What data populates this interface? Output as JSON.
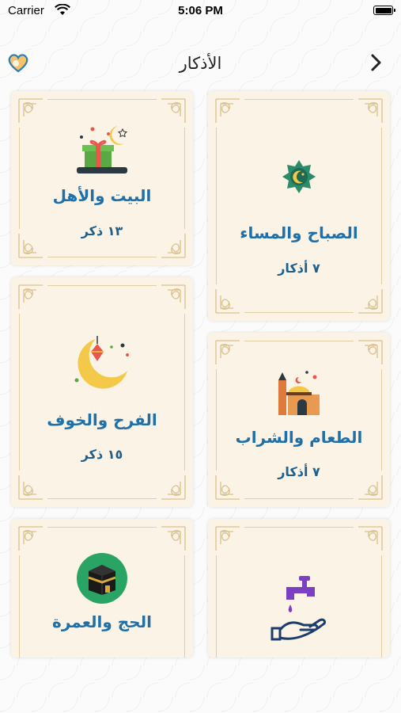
{
  "status": {
    "carrier": "Carrier",
    "time": "5:06 PM"
  },
  "nav": {
    "title": "الأذكار"
  },
  "cards": [
    {
      "name": "الصباح والمساء",
      "count": "٧ أذكار",
      "icon": "mosque-star-icon"
    },
    {
      "name": "البيت والأهل",
      "count": "١٣ ذكر",
      "icon": "gift-crescent-icon"
    },
    {
      "name": "الطعام والشراب",
      "count": "٧ أذكار",
      "icon": "mosque-dome-icon"
    },
    {
      "name": "الفرح والخوف",
      "count": "١٥ ذكر",
      "icon": "crescent-lantern-icon"
    },
    {
      "name": "",
      "count": "",
      "icon": "tap-hand-icon"
    },
    {
      "name": "الحج والعمرة",
      "count": "",
      "icon": "kaaba-icon"
    }
  ],
  "colors": {
    "accent": "#1f6fa8",
    "card_bg": "#fbf4e6",
    "frame": "#e0cfa4"
  }
}
